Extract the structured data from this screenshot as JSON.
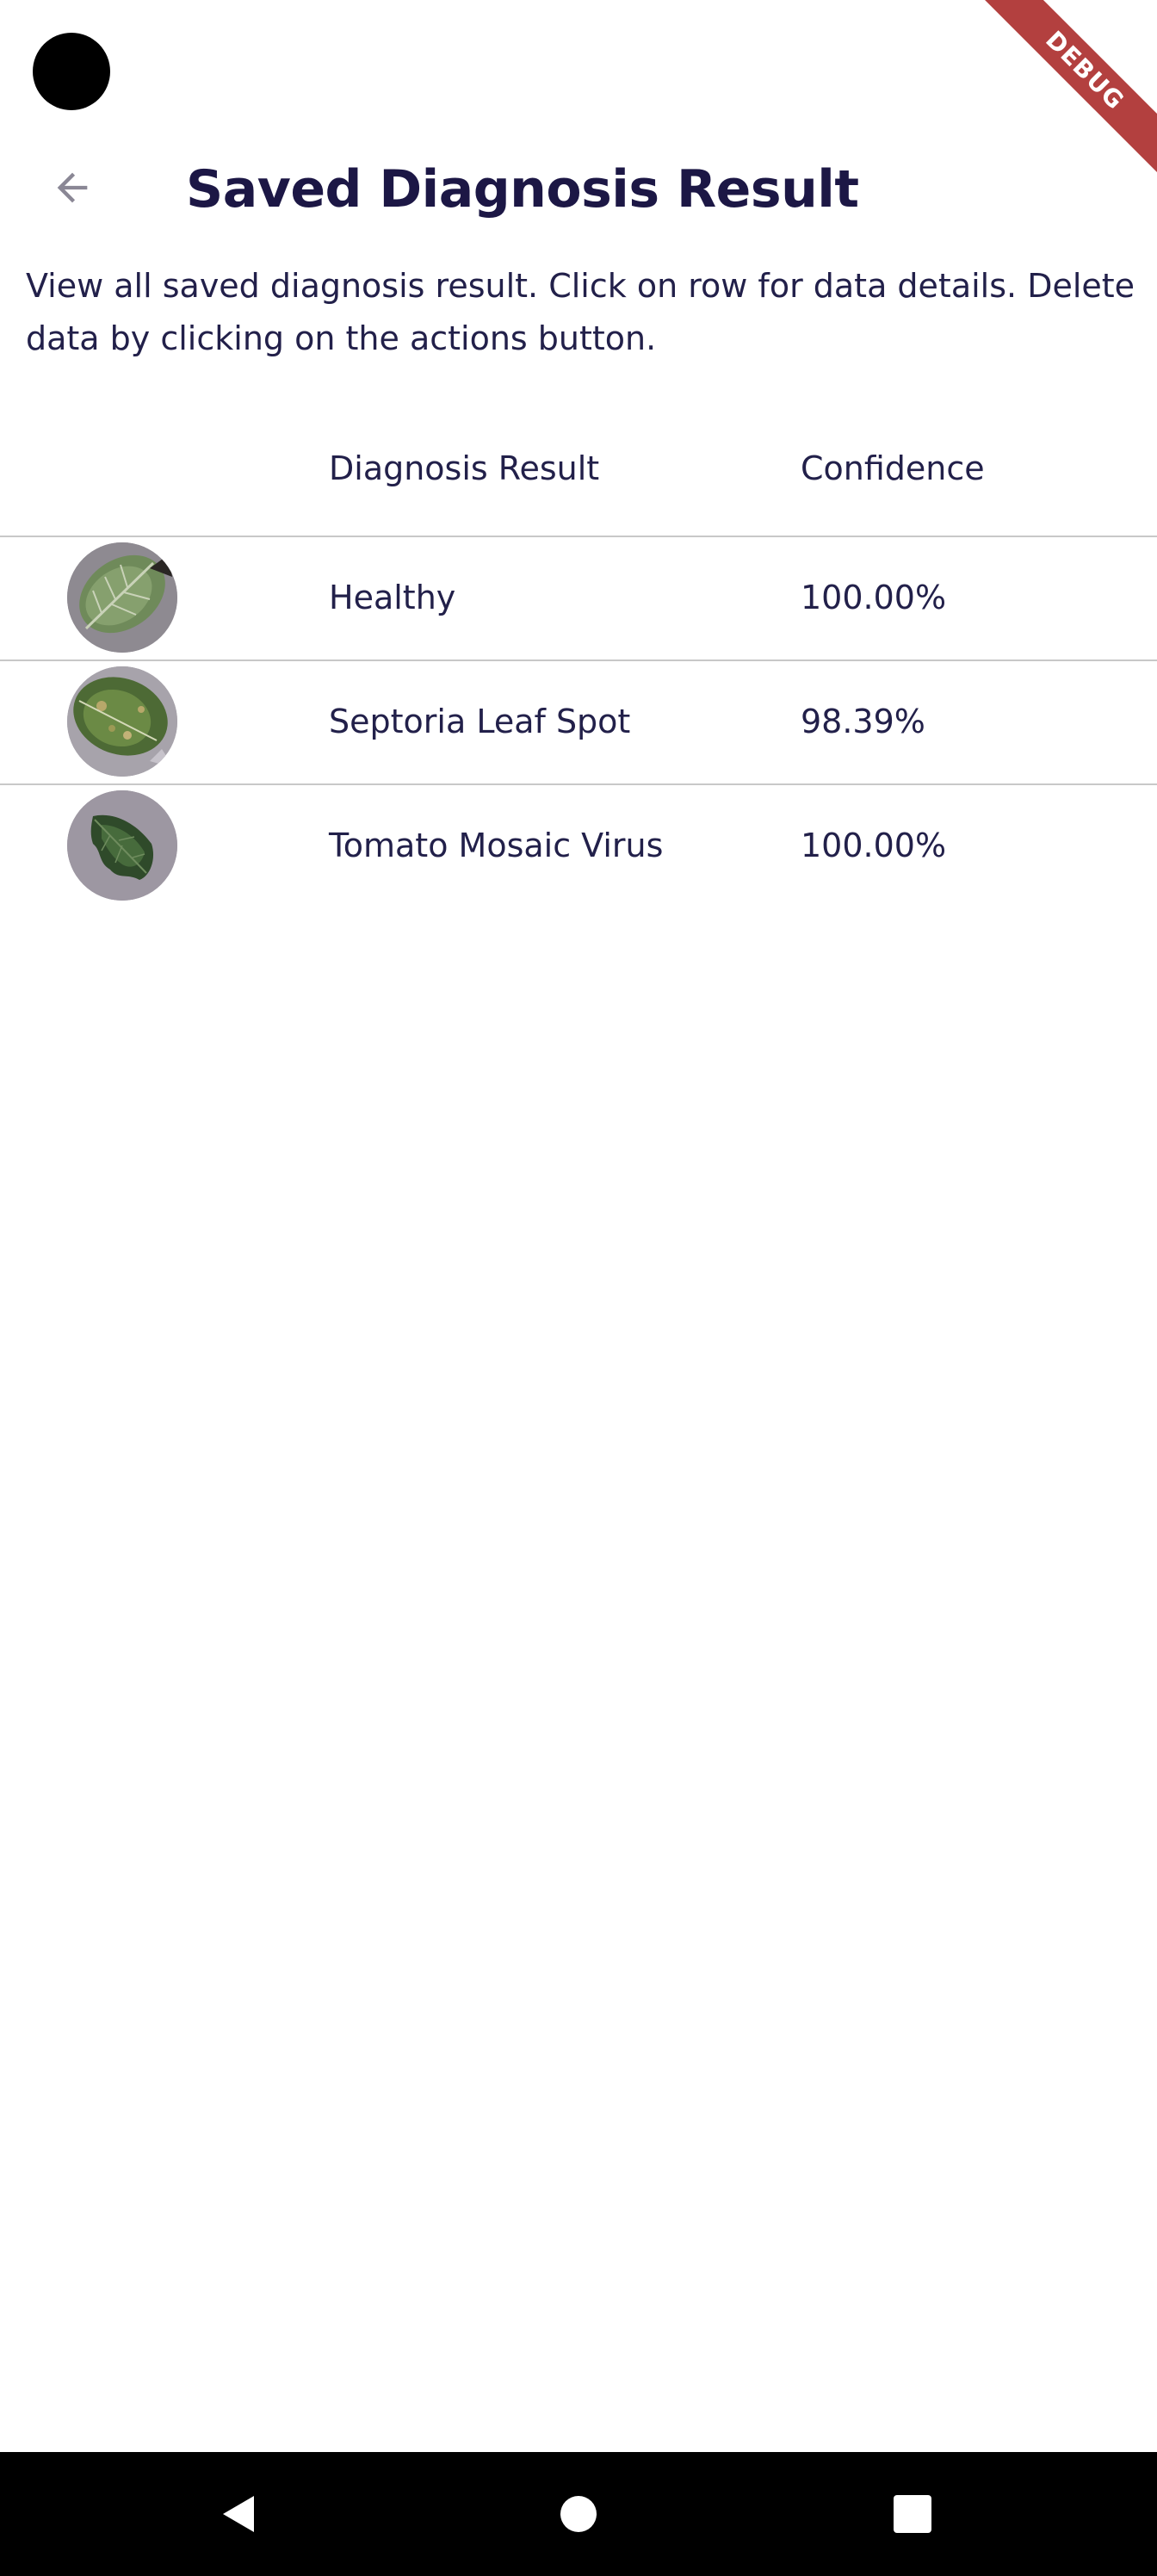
{
  "header": {
    "title": "Saved Diagnosis Result",
    "back_icon": "arrow-left-icon"
  },
  "description": "View all saved diagnosis result. Click on row for data details. Delete data by clicking on the actions button.",
  "debug_banner": "DEBUG",
  "table": {
    "columns": [
      "",
      "Diagnosis Result",
      "Confidence"
    ],
    "rows": [
      {
        "image": "leaf-thumbnail",
        "result": "Healthy",
        "confidence": "100.00%"
      },
      {
        "image": "leaf-thumbnail",
        "result": "Septoria Leaf Spot",
        "confidence": "98.39%"
      },
      {
        "image": "leaf-thumbnail",
        "result": "Tomato Mosaic Virus",
        "confidence": "100.00%"
      }
    ]
  },
  "nav_bar": {
    "buttons": [
      "nav-back-icon",
      "nav-home-icon",
      "nav-recents-icon"
    ]
  },
  "colors": {
    "title": "#1c1745",
    "text": "#22204a",
    "divider": "#c8c8c8",
    "debug_ribbon": "#b3403f",
    "back_arrow": "#8a8795"
  }
}
